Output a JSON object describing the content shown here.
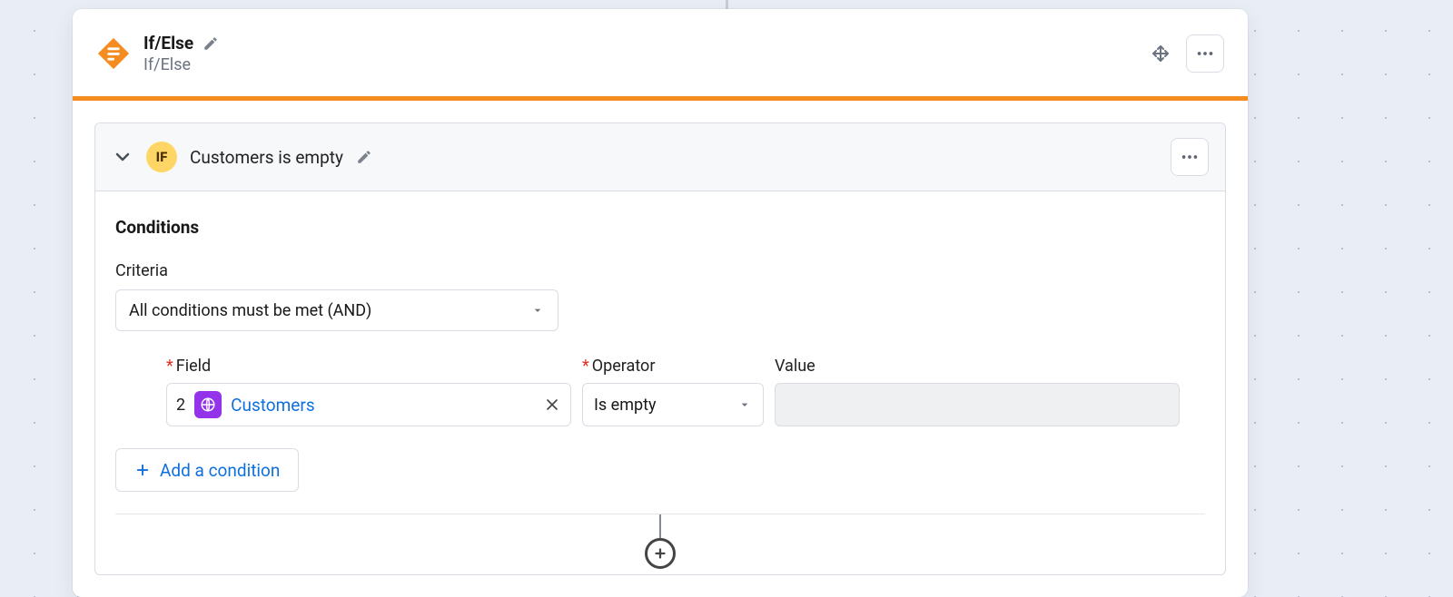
{
  "header": {
    "title": "If/Else",
    "subtitle": "If/Else"
  },
  "branch": {
    "badge": "IF",
    "name": "Customers is empty"
  },
  "conditions": {
    "section_title": "Conditions",
    "criteria_label": "Criteria",
    "criteria_value": "All conditions must be met (AND)",
    "field_label": "Field",
    "operator_label": "Operator",
    "value_label": "Value",
    "rows": [
      {
        "index": "2",
        "field_name": "Customers",
        "operator": "Is empty",
        "value": ""
      }
    ],
    "add_condition_label": "Add a condition"
  }
}
